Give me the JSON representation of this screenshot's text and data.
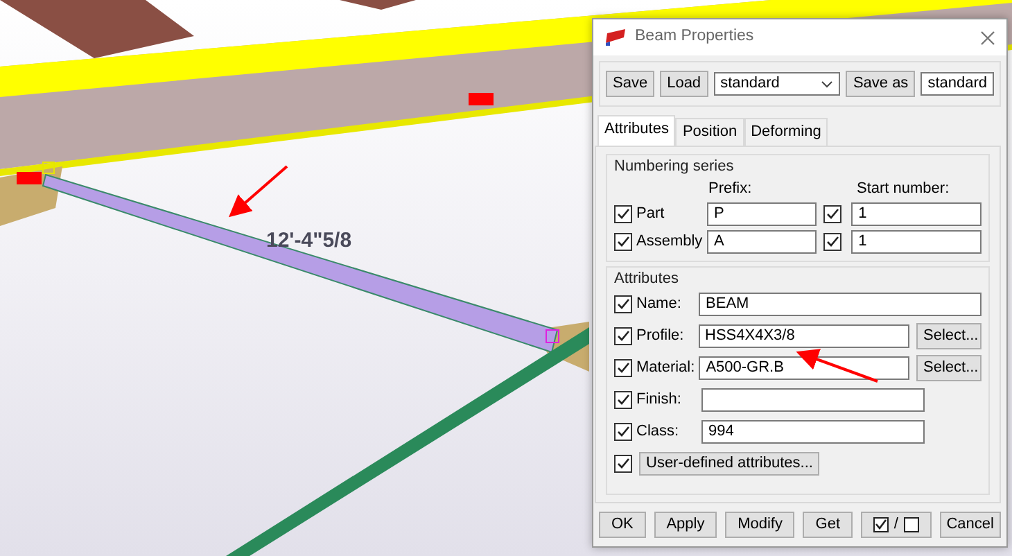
{
  "model_view": {
    "dimension_label": "12'-4\"5/8"
  },
  "window": {
    "title": "Beam Properties"
  },
  "toolbar": {
    "save_button": "Save",
    "load_button": "Load",
    "attribute_file": "standard",
    "save_as_button": "Save as",
    "save_as_name": "standard"
  },
  "tabs": [
    {
      "label": "Attributes",
      "selected": true
    },
    {
      "label": "Position",
      "selected": false
    },
    {
      "label": "Deforming",
      "selected": false
    }
  ],
  "numbering_series": {
    "legend": "Numbering series",
    "prefix_header": "Prefix:",
    "start_number_header": "Start number:",
    "rows": [
      {
        "label": "Part",
        "checked": true,
        "prefix": "P",
        "start_checked": true,
        "start_number": "1"
      },
      {
        "label": "Assembly",
        "checked": true,
        "prefix": "A",
        "start_checked": true,
        "start_number": "1"
      }
    ]
  },
  "attributes": {
    "legend": "Attributes",
    "fields": [
      {
        "kind": "text",
        "label": "Name:",
        "checked": true,
        "value": "BEAM"
      },
      {
        "kind": "select",
        "label": "Profile:",
        "checked": true,
        "value": "HSS4X4X3/8",
        "button": "Select..."
      },
      {
        "kind": "select",
        "label": "Material:",
        "checked": true,
        "value": "A500-GR.B",
        "button": "Select..."
      },
      {
        "kind": "short",
        "label": "Finish:",
        "checked": true
      },
      {
        "kind": "short",
        "label": "Class:",
        "checked": true,
        "value": "994"
      }
    ],
    "user_defined": {
      "checked": true,
      "label": "User-defined attributes..."
    }
  },
  "footer": {
    "buttons": [
      "OK",
      "Apply",
      "Modify",
      "Get"
    ],
    "toggle_separator": "/",
    "cancel_button": "Cancel"
  }
}
